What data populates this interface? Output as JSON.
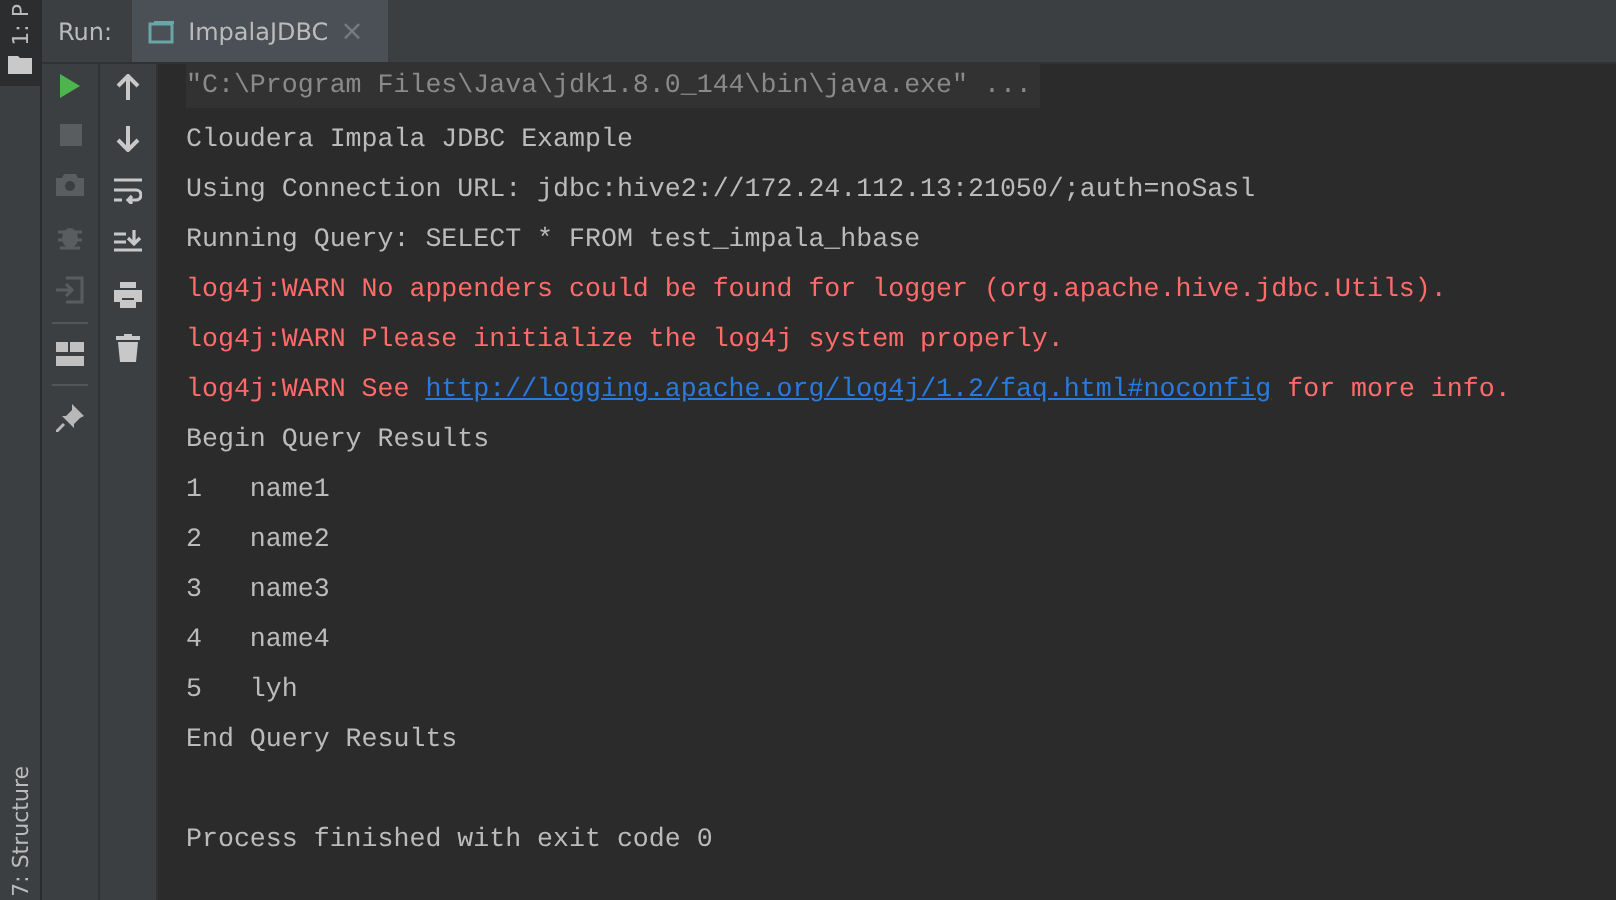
{
  "side_tabs_top": [
    {
      "label": "1: P"
    }
  ],
  "side_tabs_bottom": [
    {
      "label": "7: Structure"
    }
  ],
  "run_header": {
    "label": "Run:",
    "tab": {
      "label": "ImpalaJDBC",
      "close": "×",
      "selected": true
    }
  },
  "console": [
    {
      "kind": "cmd",
      "parts": [
        {
          "kind": "text",
          "text": "\"C:\\Program Files\\Java\\jdk1.8.0_144\\bin\\java.exe\" ..."
        }
      ]
    },
    {
      "kind": "out",
      "parts": [
        {
          "kind": "text",
          "text": "Cloudera Impala JDBC Example"
        }
      ]
    },
    {
      "kind": "out",
      "parts": [
        {
          "kind": "text",
          "text": "Using Connection URL: jdbc:hive2://172.24.112.13:21050/;auth=noSasl"
        }
      ]
    },
    {
      "kind": "out",
      "parts": [
        {
          "kind": "text",
          "text": "Running Query: SELECT * FROM test_impala_hbase"
        }
      ]
    },
    {
      "kind": "err",
      "parts": [
        {
          "kind": "text",
          "text": "log4j:WARN No appenders could be found for logger (org.apache.hive.jdbc.Utils)."
        }
      ]
    },
    {
      "kind": "err",
      "parts": [
        {
          "kind": "text",
          "text": "log4j:WARN Please initialize the log4j system properly."
        }
      ]
    },
    {
      "kind": "err",
      "parts": [
        {
          "kind": "text",
          "text": "log4j:WARN See "
        },
        {
          "kind": "link",
          "text": "http://logging.apache.org/log4j/1.2/faq.html#noconfig"
        },
        {
          "kind": "text",
          "text": " for more info."
        }
      ]
    },
    {
      "kind": "out",
      "parts": [
        {
          "kind": "text",
          "text": "Begin Query Results"
        }
      ]
    },
    {
      "kind": "out",
      "parts": [
        {
          "kind": "text",
          "text": "1   name1"
        }
      ]
    },
    {
      "kind": "out",
      "parts": [
        {
          "kind": "text",
          "text": "2   name2"
        }
      ]
    },
    {
      "kind": "out",
      "parts": [
        {
          "kind": "text",
          "text": "3   name3"
        }
      ]
    },
    {
      "kind": "out",
      "parts": [
        {
          "kind": "text",
          "text": "4   name4"
        }
      ]
    },
    {
      "kind": "out",
      "parts": [
        {
          "kind": "text",
          "text": "5   lyh"
        }
      ]
    },
    {
      "kind": "out",
      "parts": [
        {
          "kind": "text",
          "text": "End Query Results"
        }
      ]
    },
    {
      "kind": "gap"
    },
    {
      "kind": "out",
      "parts": [
        {
          "kind": "text",
          "text": "Process finished with exit code 0"
        }
      ]
    }
  ]
}
